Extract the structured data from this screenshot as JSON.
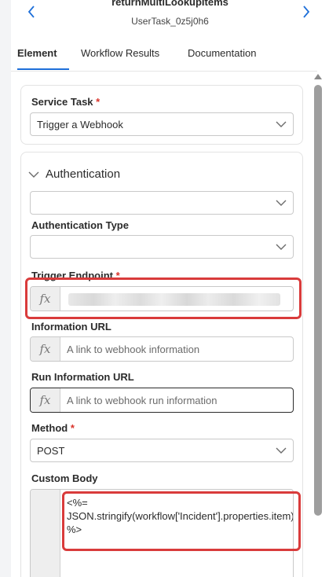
{
  "header": {
    "title": "returnMultiLookupItems",
    "subtitle": "UserTask_0z5j0h6",
    "prev_icon": "chevron-left-icon",
    "next_icon": "chevron-right-icon"
  },
  "tabs": [
    {
      "label": "Element",
      "active": true
    },
    {
      "label": "Workflow Results",
      "active": false
    },
    {
      "label": "Documentation",
      "active": false
    }
  ],
  "service_task": {
    "label": "Service Task",
    "required_mark": "*",
    "value": "Trigger a Webhook"
  },
  "authentication": {
    "toggle_label": "Authentication",
    "value": "",
    "type_label": "Authentication Type",
    "type_value": ""
  },
  "trigger_endpoint": {
    "label": "Trigger Endpoint",
    "required_mark": "*",
    "fx": "fx"
  },
  "information_url": {
    "label": "Information URL",
    "fx": "fx",
    "placeholder": "A link to webhook information"
  },
  "run_information_url": {
    "label": "Run Information URL",
    "fx": "fx",
    "placeholder": "A link to webhook run information"
  },
  "method": {
    "label": "Method",
    "required_mark": "*",
    "value": "POST"
  },
  "custom_body": {
    "label": "Custom Body",
    "code": "<%=\nJSON.stringify(workflow['Incident'].properties.item) %>"
  },
  "colors": {
    "accent": "#1e6fd9",
    "highlight": "#d93b3b",
    "required": "#d9342b"
  }
}
